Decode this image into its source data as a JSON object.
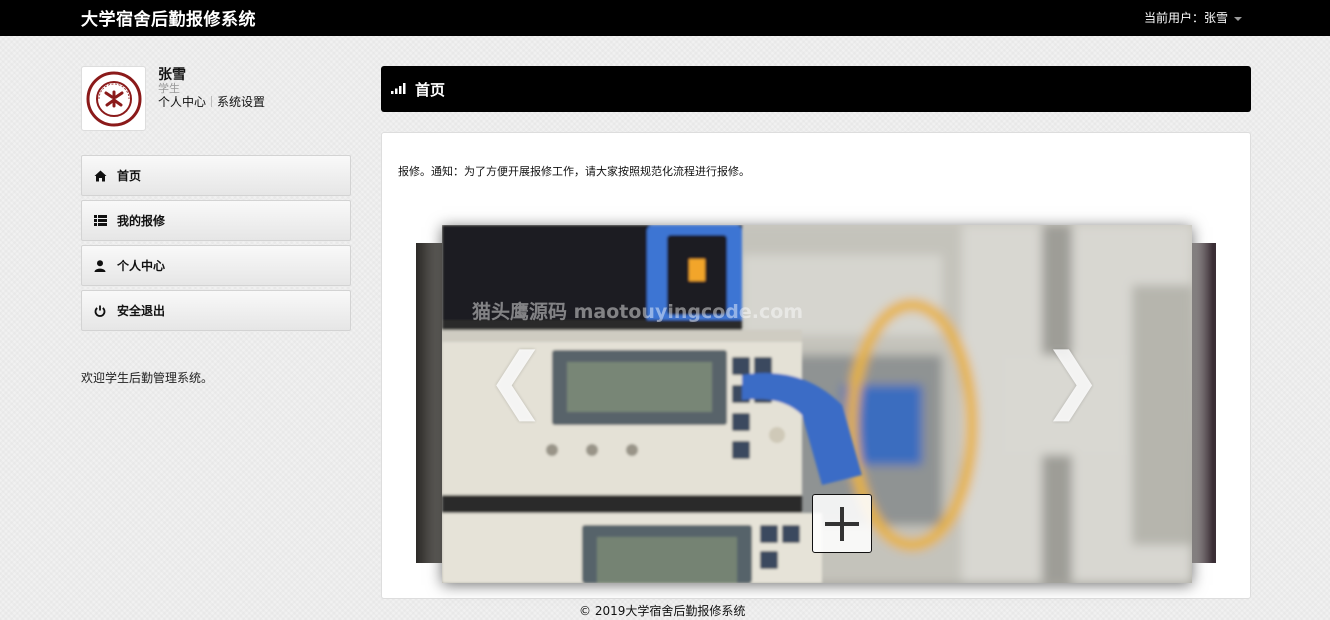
{
  "app": {
    "brand": "大学宿舍后勤报修系统",
    "current_user": "当前用户：张雪"
  },
  "profile": {
    "name": "张雪",
    "role": "学生",
    "link_center": "个人中心",
    "link_settings": "系统设置"
  },
  "sidebar": {
    "items": [
      {
        "label": "首页",
        "icon": "home-icon"
      },
      {
        "label": "我的报修",
        "icon": "list-icon"
      },
      {
        "label": "个人中心",
        "icon": "user-icon"
      },
      {
        "label": "安全退出",
        "icon": "power-icon"
      }
    ],
    "welcome": "欢迎学生后勤管理系统。"
  },
  "main": {
    "header_title": "首页",
    "header_icon": "signal-icon",
    "notice": "报修。通知：为了方便开展报修工作，请大家按照规范化流程进行报修。",
    "carousel": {
      "prev": "❮",
      "next": "❯",
      "watermark": "猫头鹰源码 maotouyingcode.com",
      "add_icon": "plus-icon"
    }
  },
  "footer": {
    "text": "© 2019大学宿舍后勤报修系统"
  },
  "colors": {
    "navbar": "#000000",
    "page_bg": "#f1f1f1",
    "logo_red": "#8b1a1a"
  }
}
